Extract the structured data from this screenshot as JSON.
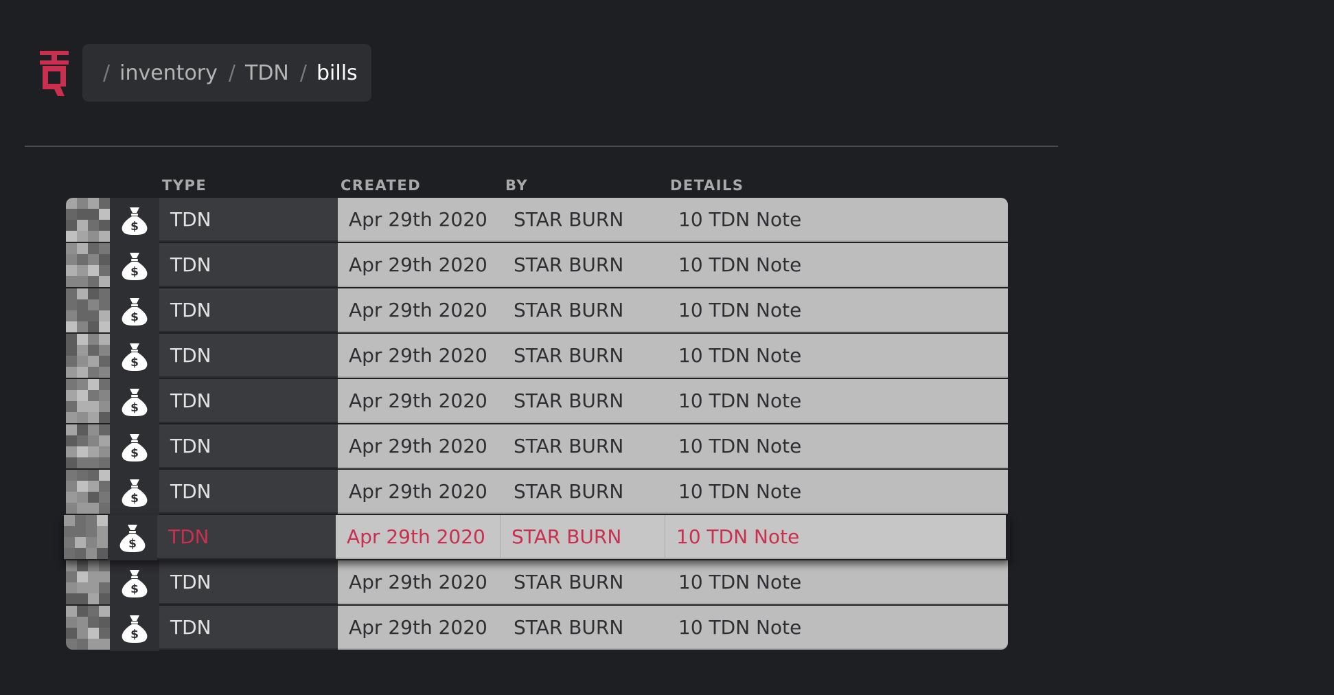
{
  "colors": {
    "accent": "#c9304f",
    "background": "#1e1f23"
  },
  "logo": {
    "icon": "tq-logo-icon"
  },
  "breadcrumb": {
    "separator": "/",
    "items": [
      "inventory",
      "TDN",
      "bills"
    ]
  },
  "table": {
    "headers": {
      "type": "TYPE",
      "created": "CREATED",
      "by": "BY",
      "details": "DETAILS"
    },
    "row_icon": "money-bag-icon",
    "selected_row_index": 7,
    "rows": [
      {
        "type": "TDN",
        "created": "Apr 29th 2020",
        "by": "STAR BURN",
        "details": "10 TDN Note"
      },
      {
        "type": "TDN",
        "created": "Apr 29th 2020",
        "by": "STAR BURN",
        "details": "10 TDN Note"
      },
      {
        "type": "TDN",
        "created": "Apr 29th 2020",
        "by": "STAR BURN",
        "details": "10 TDN Note"
      },
      {
        "type": "TDN",
        "created": "Apr 29th 2020",
        "by": "STAR BURN",
        "details": "10 TDN Note"
      },
      {
        "type": "TDN",
        "created": "Apr 29th 2020",
        "by": "STAR BURN",
        "details": "10 TDN Note"
      },
      {
        "type": "TDN",
        "created": "Apr 29th 2020",
        "by": "STAR BURN",
        "details": "10 TDN Note"
      },
      {
        "type": "TDN",
        "created": "Apr 29th 2020",
        "by": "STAR BURN",
        "details": "10 TDN Note"
      },
      {
        "type": "TDN",
        "created": "Apr 29th 2020",
        "by": "STAR BURN",
        "details": "10 TDN Note"
      },
      {
        "type": "TDN",
        "created": "Apr 29th 2020",
        "by": "STAR BURN",
        "details": "10 TDN Note"
      },
      {
        "type": "TDN",
        "created": "Apr 29th 2020",
        "by": "STAR BURN",
        "details": "10 TDN Note"
      }
    ]
  }
}
